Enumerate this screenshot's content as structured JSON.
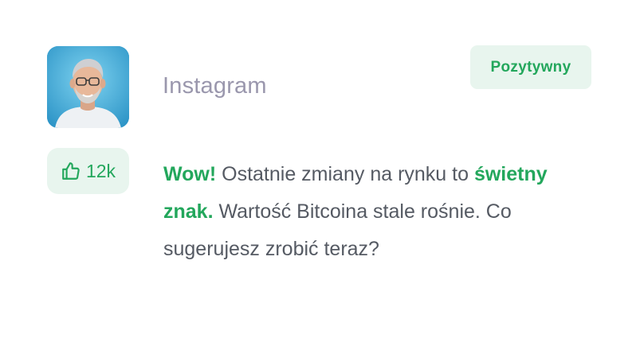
{
  "post": {
    "source": "Instagram",
    "sentiment_label": "Pozytywny",
    "likes": "12k",
    "message": {
      "part1_highlight": "Wow!",
      "part2": " Ostatnie zmiany na rynku to ",
      "part3_highlight": "świetny znak.",
      "part4": " Wartość Bitcoina stale rośnie. Co sugerujesz zrobić teraz?"
    }
  },
  "icons": {
    "likes": "thumbs-up-icon"
  },
  "colors": {
    "accent_green": "#23a75c",
    "badge_bg": "#e8f5ee",
    "source_text": "#9a97ad",
    "body_text": "#555a63"
  }
}
